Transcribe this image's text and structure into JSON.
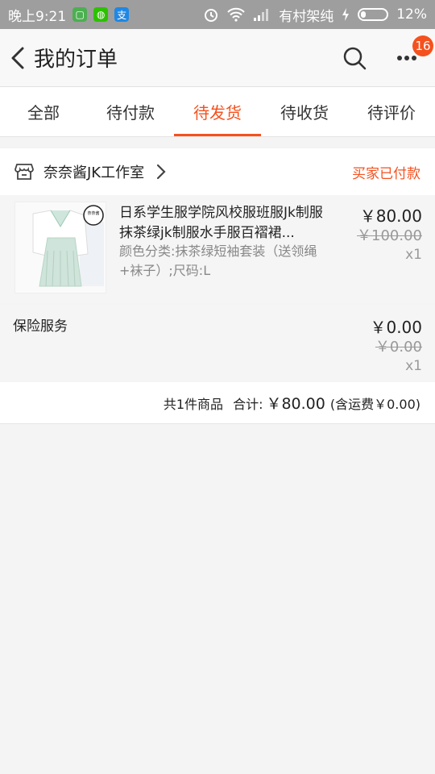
{
  "status_bar": {
    "time": "晚上9:21",
    "carrier": "有村架纯",
    "battery": "12%",
    "app_icons": [
      "green-app-icon",
      "wechat-icon",
      "alipay-icon"
    ]
  },
  "header": {
    "title": "我的订单",
    "more_badge": "16"
  },
  "tabs": [
    {
      "label": "全部",
      "active": false
    },
    {
      "label": "待付款",
      "active": false
    },
    {
      "label": "待发货",
      "active": true
    },
    {
      "label": "待收货",
      "active": false
    },
    {
      "label": "待评价",
      "active": false
    }
  ],
  "order": {
    "shop_name": "奈奈酱JK工作室",
    "status": "买家已付款",
    "item": {
      "title": "日系学生服学院风校服班服Jk制服抹茶绿jk制服水手服百褶裙...",
      "spec": "颜色分类:抹茶绿短袖套装（送领绳+袜子）;尺码:L",
      "price": "￥80.00",
      "original_price": "￥100.00",
      "quantity": "x1",
      "thumb_stamp": "奈奈酱"
    },
    "insurance": {
      "label": "保险服务",
      "price": "￥0.00",
      "original_price": "￥0.00",
      "quantity": "x1"
    },
    "summary": {
      "count_text": "共1件商品",
      "total_label": "合计:",
      "total": "￥80.00",
      "shipping": "(含运费￥0.00)"
    }
  },
  "colors": {
    "accent": "#f5511e",
    "status_bar": "#9e9e9e"
  }
}
